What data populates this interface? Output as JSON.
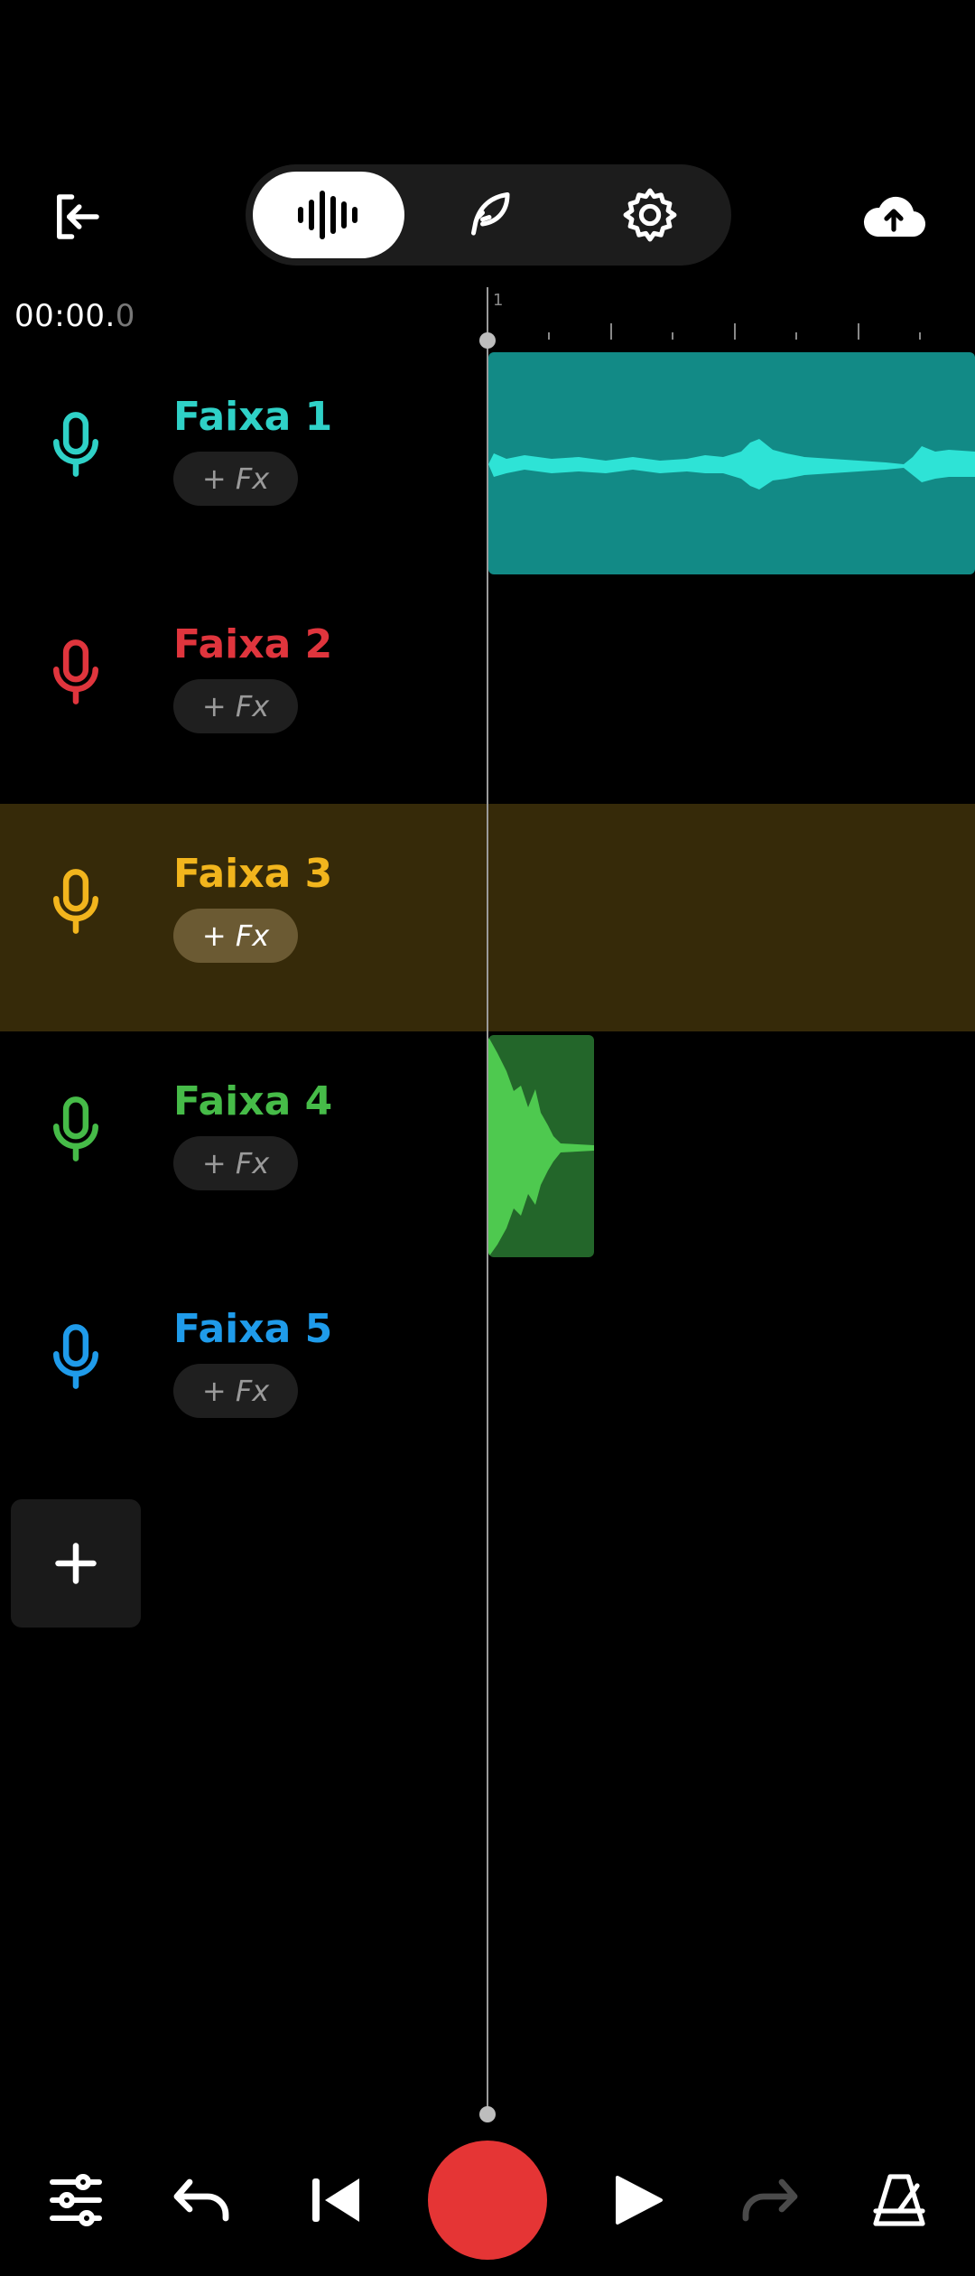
{
  "toolbar": {
    "exit_icon": "exit-icon",
    "tabs": [
      {
        "icon": "waveform-icon",
        "active": true
      },
      {
        "icon": "feather-icon",
        "active": false
      },
      {
        "icon": "gear-icon",
        "active": false
      }
    ],
    "upload_icon": "cloud-upload-icon"
  },
  "timeline": {
    "time_main": "00:00.",
    "time_fraction": "0",
    "ruler_label": "1"
  },
  "tracks": [
    {
      "name": "Faixa 1",
      "fx_label": "+ Fx",
      "color": "#2fd1c7",
      "selected": false
    },
    {
      "name": "Faixa 2",
      "fx_label": "+ Fx",
      "color": "#e0353d",
      "selected": false
    },
    {
      "name": "Faixa 3",
      "fx_label": "+ Fx",
      "color": "#f2b51d",
      "selected": true
    },
    {
      "name": "Faixa 4",
      "fx_label": "+ Fx",
      "color": "#46bb48",
      "selected": false
    },
    {
      "name": "Faixa 5",
      "fx_label": "+ Fx",
      "color": "#1f9bea",
      "selected": false
    }
  ],
  "clips": [
    {
      "track": "Faixa 1",
      "color": "#128a86",
      "wave_color": "#2ee3d6"
    },
    {
      "track": "Faixa 4",
      "color": "#23662a",
      "wave_color": "#4ec94f"
    }
  ],
  "bottom_bar": {
    "icons": [
      "mixer-sliders-icon",
      "undo-icon",
      "skip-to-start-icon",
      "record-icon",
      "play-icon",
      "redo-icon",
      "metronome-icon"
    ],
    "record_color": "#e53535"
  }
}
